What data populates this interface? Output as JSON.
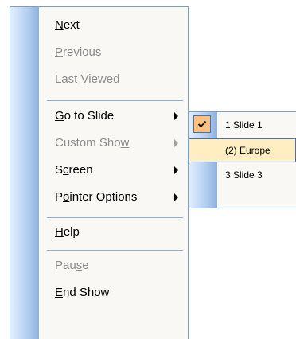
{
  "context_menu": {
    "items": [
      {
        "pre": "",
        "key": "N",
        "post": "ext",
        "enabled": true
      },
      {
        "pre": "",
        "key": "P",
        "post": "revious",
        "enabled": false
      },
      {
        "pre": "Last ",
        "key": "V",
        "post": "iewed",
        "enabled": false
      },
      {
        "pre": "",
        "key": "G",
        "post": "o to Slide",
        "enabled": true
      },
      {
        "pre": "Custom Sho",
        "key": "w",
        "post": "",
        "enabled": false
      },
      {
        "pre": "S",
        "key": "c",
        "post": "reen",
        "enabled": true
      },
      {
        "pre": "P",
        "key": "o",
        "post": "inter Options",
        "enabled": true
      },
      {
        "pre": "",
        "key": "H",
        "post": "elp",
        "enabled": true
      },
      {
        "pre": "Pau",
        "key": "s",
        "post": "e",
        "enabled": false
      },
      {
        "pre": "",
        "key": "E",
        "post": "nd Show",
        "enabled": true
      }
    ]
  },
  "slide_submenu": {
    "items": [
      {
        "label": "1 Slide 1",
        "checked": true
      },
      {
        "label": "(2) Europe",
        "highlighted": true
      },
      {
        "label": "3 Slide 3"
      }
    ]
  },
  "colors": {
    "highlight_fill": "#ffeec2",
    "highlight_border": "#4b6fa8",
    "check_fill": "#ffc080",
    "disabled_text": "#8d8d8d"
  }
}
